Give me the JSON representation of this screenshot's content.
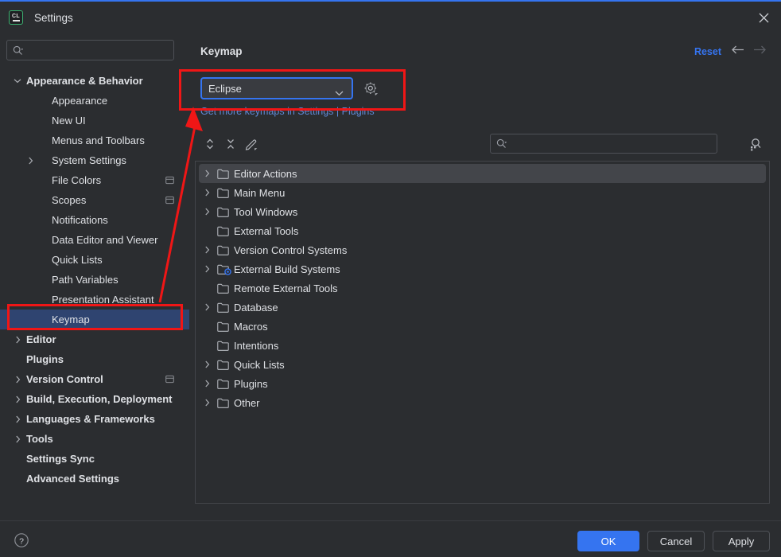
{
  "window": {
    "title": "Settings",
    "app_icon": "clion-icon",
    "app_icon_text": "CL",
    "close_icon": "close-icon"
  },
  "sidebar": {
    "search": {
      "placeholder": "",
      "value": "",
      "icon": "search-icon"
    },
    "items": [
      {
        "label": "Appearance & Behavior",
        "level": 0,
        "expandable": true,
        "expanded": true,
        "selected": false,
        "badge": false
      },
      {
        "label": "Appearance",
        "level": 1,
        "expandable": false,
        "expanded": false,
        "selected": false,
        "badge": false
      },
      {
        "label": "New UI",
        "level": 1,
        "expandable": false,
        "expanded": false,
        "selected": false,
        "badge": false
      },
      {
        "label": "Menus and Toolbars",
        "level": 1,
        "expandable": false,
        "expanded": false,
        "selected": false,
        "badge": false
      },
      {
        "label": "System Settings",
        "level": 1,
        "expandable": true,
        "expanded": false,
        "selected": false,
        "badge": false
      },
      {
        "label": "File Colors",
        "level": 1,
        "expandable": false,
        "expanded": false,
        "selected": false,
        "badge": true
      },
      {
        "label": "Scopes",
        "level": 1,
        "expandable": false,
        "expanded": false,
        "selected": false,
        "badge": true
      },
      {
        "label": "Notifications",
        "level": 1,
        "expandable": false,
        "expanded": false,
        "selected": false,
        "badge": false
      },
      {
        "label": "Data Editor and Viewer",
        "level": 1,
        "expandable": false,
        "expanded": false,
        "selected": false,
        "badge": false
      },
      {
        "label": "Quick Lists",
        "level": 1,
        "expandable": false,
        "expanded": false,
        "selected": false,
        "badge": false
      },
      {
        "label": "Path Variables",
        "level": 1,
        "expandable": false,
        "expanded": false,
        "selected": false,
        "badge": false
      },
      {
        "label": "Presentation Assistant",
        "level": 1,
        "expandable": false,
        "expanded": false,
        "selected": false,
        "badge": false
      },
      {
        "label": "Keymap",
        "level": 1,
        "expandable": false,
        "expanded": false,
        "selected": true,
        "badge": false
      },
      {
        "label": "Editor",
        "level": 0,
        "expandable": true,
        "expanded": false,
        "selected": false,
        "badge": false
      },
      {
        "label": "Plugins",
        "level": 0,
        "expandable": false,
        "expanded": false,
        "selected": false,
        "badge": false
      },
      {
        "label": "Version Control",
        "level": 0,
        "expandable": true,
        "expanded": false,
        "selected": false,
        "badge": true
      },
      {
        "label": "Build, Execution, Deployment",
        "level": 0,
        "expandable": true,
        "expanded": false,
        "selected": false,
        "badge": false
      },
      {
        "label": "Languages & Frameworks",
        "level": 0,
        "expandable": true,
        "expanded": false,
        "selected": false,
        "badge": false
      },
      {
        "label": "Tools",
        "level": 0,
        "expandable": true,
        "expanded": false,
        "selected": false,
        "badge": false
      },
      {
        "label": "Settings Sync",
        "level": 0,
        "expandable": false,
        "expanded": false,
        "selected": false,
        "badge": false
      },
      {
        "label": "Advanced Settings",
        "level": 0,
        "expandable": false,
        "expanded": false,
        "selected": false,
        "badge": false
      }
    ]
  },
  "main": {
    "title": "Keymap",
    "reset_label": "Reset",
    "back_icon": "arrow-left-icon",
    "forward_icon": "arrow-right-icon",
    "keymap_select": {
      "value": "Eclipse",
      "options": [
        "Eclipse"
      ],
      "chevron_icon": "chevron-down-icon",
      "gear_icon": "gear-icon"
    },
    "more_keymaps_link": "Get more keymaps in Settings | Plugins",
    "toolbar": {
      "expand_all_icon": "expand-all-icon",
      "collapse_all_icon": "collapse-all-icon",
      "edit_icon": "pencil-edit-icon",
      "find_shortcut_icon": "find-by-shortcut-icon",
      "search": {
        "placeholder": "",
        "value": "",
        "icon": "search-icon"
      }
    },
    "tree": [
      {
        "label": "Editor Actions",
        "expandable": true,
        "selected": true,
        "icon": "folder-icon"
      },
      {
        "label": "Main Menu",
        "expandable": true,
        "selected": false,
        "icon": "folder-icon"
      },
      {
        "label": "Tool Windows",
        "expandable": true,
        "selected": false,
        "icon": "folder-icon"
      },
      {
        "label": "External Tools",
        "expandable": false,
        "selected": false,
        "icon": "folder-icon"
      },
      {
        "label": "Version Control Systems",
        "expandable": true,
        "selected": false,
        "icon": "folder-icon"
      },
      {
        "label": "External Build Systems",
        "expandable": true,
        "selected": false,
        "icon": "folder-gear-icon"
      },
      {
        "label": "Remote External Tools",
        "expandable": false,
        "selected": false,
        "icon": "folder-icon"
      },
      {
        "label": "Database",
        "expandable": true,
        "selected": false,
        "icon": "folder-icon"
      },
      {
        "label": "Macros",
        "expandable": false,
        "selected": false,
        "icon": "folder-icon"
      },
      {
        "label": "Intentions",
        "expandable": false,
        "selected": false,
        "icon": "folder-icon"
      },
      {
        "label": "Quick Lists",
        "expandable": true,
        "selected": false,
        "icon": "folder-icon"
      },
      {
        "label": "Plugins",
        "expandable": true,
        "selected": false,
        "icon": "folder-icon"
      },
      {
        "label": "Other",
        "expandable": true,
        "selected": false,
        "icon": "folder-icon"
      }
    ]
  },
  "footer": {
    "help_icon": "help-icon",
    "ok_label": "OK",
    "cancel_label": "Cancel",
    "apply_label": "Apply"
  },
  "colors": {
    "accent": "#3574f0",
    "background": "#2b2d30",
    "selection_sidebar": "#2f4470",
    "selection_tree": "#43454a",
    "link": "#5f89d6",
    "annotation": "#f01616",
    "icon_green": "#3cb371"
  }
}
